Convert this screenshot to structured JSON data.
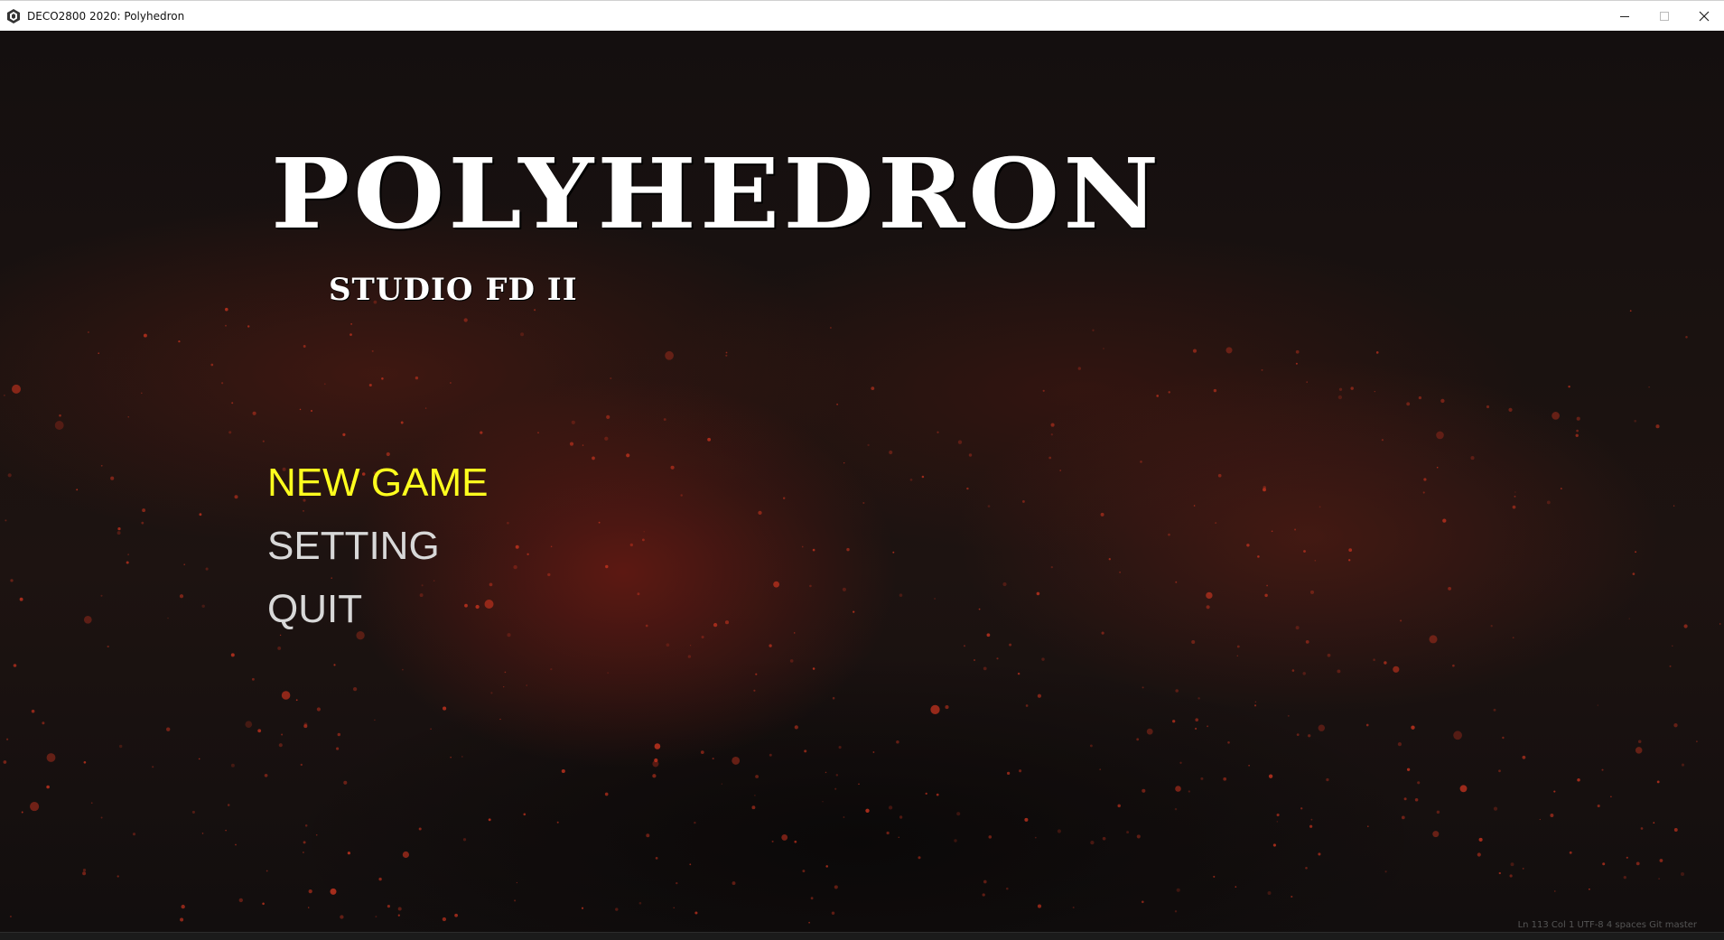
{
  "window": {
    "title": "DECO2800 2020: Polyhedron",
    "controls": {
      "minimize_icon": "minimize-icon",
      "maximize_icon": "maximize-icon",
      "close_icon": "close-icon"
    }
  },
  "logo": {
    "title": "POLYHEDRON",
    "subtitle": "STUDIO FD II"
  },
  "menu": {
    "items": [
      {
        "label": "NEW GAME",
        "selected": true
      },
      {
        "label": "SETTING",
        "selected": false
      },
      {
        "label": "QUIT",
        "selected": false
      }
    ]
  },
  "status": {
    "text": "Ln 113   Col 1   UTF-8   4 spaces   Git master"
  },
  "colors": {
    "menu_selected": "#ffff1e",
    "menu_default": "#d8d8d8",
    "background": "#141010",
    "ember": "#c0321e"
  }
}
